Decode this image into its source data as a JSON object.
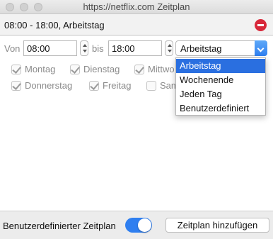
{
  "window": {
    "title": "https://netflix.com Zeitplan"
  },
  "schedule": {
    "title": "08:00 - 18:00, Arbeitstag"
  },
  "time": {
    "from_label": "Von",
    "from_value": "08:00",
    "to_label": "bis",
    "to_value": "18:00"
  },
  "preset": {
    "selected": "Arbeitstag",
    "options": [
      "Arbeitstag",
      "Wochenende",
      "Jeden Tag",
      "Benutzerdefiniert"
    ]
  },
  "days": [
    {
      "label": "Montag",
      "checked": true
    },
    {
      "label": "Dienstag",
      "checked": true
    },
    {
      "label": "Mittwo",
      "checked": true
    },
    {
      "label": "Donnerstag",
      "checked": true
    },
    {
      "label": "Freitag",
      "checked": true
    },
    {
      "label": "Sam",
      "checked": false
    }
  ],
  "footer": {
    "custom_schedule_label": "Benutzerdefinierter Zeitplan",
    "toggle_on": true,
    "add_button_label": "Zeitplan hinzufügen"
  },
  "colors": {
    "accent": "#2f7ff0",
    "remove": "#d8283a",
    "menu_highlight": "#2a6fe0"
  }
}
